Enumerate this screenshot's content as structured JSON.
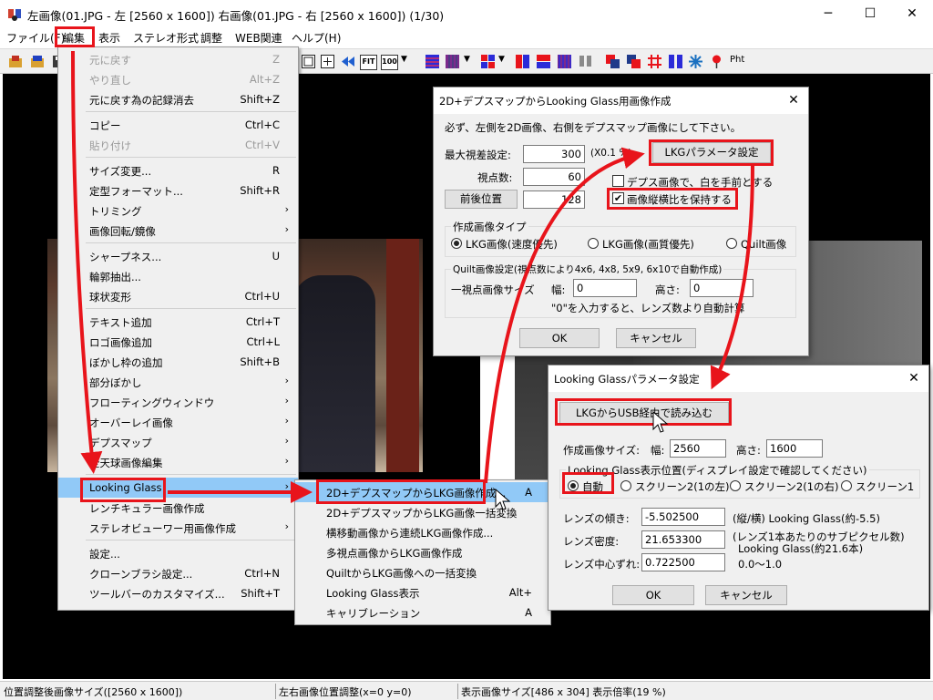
{
  "window": {
    "title": "左画像(01.JPG - 左 [2560 x 1600]) 右画像(01.JPG - 右 [2560 x 1600]) (1/30)",
    "controls": {
      "minimize": "─",
      "maximize": "☐",
      "close": "✕"
    }
  },
  "menubar": [
    "ファイル(F)",
    "編集",
    "表示",
    "ステレオ形式",
    "調整",
    "WEB関連",
    "ヘルプ(H)"
  ],
  "toolbar": {
    "text_icons": {
      "fit": "FIT",
      "zoom100": "100",
      "pht": "Pht"
    },
    "colors": {
      "red": "#e8141b",
      "blue": "#2b2bd8",
      "purple": "#7c2a8c",
      "darkblue": "#1f3a8a"
    }
  },
  "edit_menu": {
    "items": [
      {
        "label": "元に戻す",
        "shortcut": "Z",
        "disabled": true
      },
      {
        "label": "やり直し",
        "shortcut": "Alt+Z",
        "disabled": true
      },
      {
        "label": "元に戻す為の記録消去",
        "shortcut": "Shift+Z"
      },
      {
        "sep": true
      },
      {
        "label": "コピー",
        "shortcut": "Ctrl+C"
      },
      {
        "label": "貼り付け",
        "shortcut": "Ctrl+V",
        "disabled": true
      },
      {
        "sep": true
      },
      {
        "label": "サイズ変更...",
        "shortcut": "R"
      },
      {
        "label": "定型フォーマット...",
        "shortcut": "Shift+R"
      },
      {
        "label": "トリミング",
        "submenu": true
      },
      {
        "label": "画像回転/鏡像",
        "submenu": true
      },
      {
        "sep": true
      },
      {
        "label": "シャープネス...",
        "shortcut": "U"
      },
      {
        "label": "輪郭抽出..."
      },
      {
        "label": "球状変形",
        "shortcut": "Ctrl+U"
      },
      {
        "sep": true
      },
      {
        "label": "テキスト追加",
        "shortcut": "Ctrl+T"
      },
      {
        "label": "ロゴ画像追加",
        "shortcut": "Ctrl+L"
      },
      {
        "label": "ぼかし枠の追加",
        "shortcut": "Shift+B"
      },
      {
        "label": "部分ぼかし",
        "submenu": true
      },
      {
        "label": "フローティングウィンドウ",
        "submenu": true
      },
      {
        "label": "オーバーレイ画像",
        "submenu": true
      },
      {
        "label": "デプスマップ",
        "submenu": true
      },
      {
        "label": "全天球画像編集",
        "submenu": true
      },
      {
        "sep": true
      },
      {
        "label": "Looking Glass",
        "submenu": true,
        "selected": true
      },
      {
        "label": "レンチキュラー画像作成"
      },
      {
        "label": "ステレオビューワー用画像作成",
        "submenu": true
      },
      {
        "sep": true
      },
      {
        "label": "設定..."
      },
      {
        "label": "クローンブラシ設定...",
        "shortcut": "Ctrl+N"
      },
      {
        "label": "ツールバーのカスタマイズ...",
        "shortcut": "Shift+T"
      }
    ]
  },
  "lkg_submenu": {
    "items": [
      {
        "label": "2D+デプスマップからLKG画像作成...",
        "shortcut": "A",
        "selected": true
      },
      {
        "label": "2D+デプスマップからLKG画像一括変換"
      },
      {
        "label": "横移動画像から連続LKG画像作成..."
      },
      {
        "label": "多視点画像からLKG画像作成"
      },
      {
        "label": "QuiltからLKG画像への一括変換"
      },
      {
        "label": "Looking Glass表示",
        "shortcut": "Alt+"
      },
      {
        "label": "キャリブレーション",
        "shortcut": "A"
      }
    ]
  },
  "dialog_create": {
    "title": "2D+デプスマップからLooking Glass用画像作成",
    "instruction": "必ず、左側を2D画像、右側をデプスマップ画像にして下さい。",
    "max_parallax_label": "最大視差設定:",
    "max_parallax_value": "300",
    "max_parallax_unit": "(X0.1 %)",
    "viewpoints_label": "視点数:",
    "viewpoints_value": "60",
    "position_button": "前後位置",
    "position_value": "128",
    "params_button": "LKGパラメータ設定",
    "depth_white_front": "デプス画像で、白を手前とする",
    "keep_aspect": "画像縦横比を保持する",
    "image_type_group": "作成画像タイプ",
    "image_types": [
      "LKG画像(速度優先)",
      "LKG画像(画質優先)",
      "Quilt画像"
    ],
    "quilt_group": "Quilt画像設定(視点数により4x6, 4x8, 5x9, 6x10で自動作成)",
    "one_view_size": "一視点画像サイズ",
    "width_label": "幅:",
    "width_value": "0",
    "height_label": "高さ:",
    "height_value": "0",
    "hint": "\"0\"を入力すると、レンズ数より自動計算",
    "ok": "OK",
    "cancel": "キャンセル"
  },
  "dialog_params": {
    "title": "Looking Glassパラメータ設定",
    "usb_button": "LKGからUSB経由で読み込む",
    "size_label": "作成画像サイズ:",
    "width_label": "幅:",
    "width_value": "2560",
    "height_label": "高さ:",
    "height_value": "1600",
    "position_group": "Looking Glass表示位置(ディスプレイ設定で確認してください)",
    "positions": [
      "自動",
      "スクリーン2(1の左)",
      "スクリーン2(1の右)",
      "スクリーン1"
    ],
    "slope_label": "レンズの傾き:",
    "slope_value": "-5.502500",
    "slope_hint": "(縦/横) Looking Glass(約-5.5)",
    "density_label": "レンズ密度:",
    "density_value": "21.653300",
    "density_hint1": "(レンズ1本あたりのサブピクセル数)",
    "density_hint2": "Looking Glass(約21.6本)",
    "offset_label": "レンズ中心ずれ:",
    "offset_value": "0.722500",
    "offset_hint": "0.0〜1.0",
    "ok": "OK",
    "cancel": "キャンセル"
  },
  "statusbar": {
    "adjusted_size": "位置調整後画像サイズ([2560 x 1600])",
    "lr_position": "左右画像位置調整(x=0 y=0)",
    "display_size": "表示画像サイズ[486 x 304] 表示倍率(19 %)"
  },
  "highlight_color": "#e8141b"
}
